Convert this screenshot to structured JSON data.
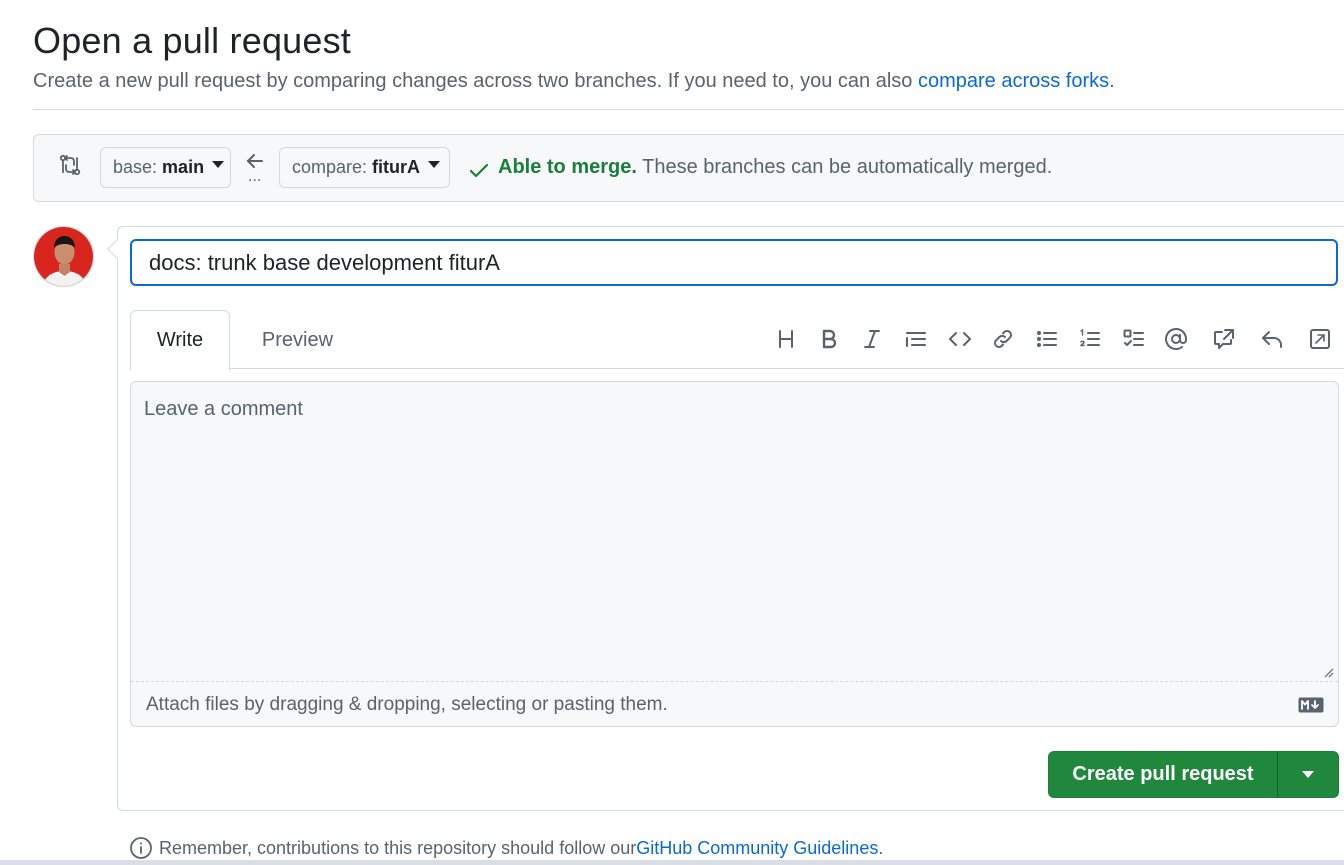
{
  "header": {
    "title": "Open a pull request",
    "subtitle": "Create a new pull request by comparing changes across two branches. If you need to, you can also ",
    "subtitle_link": "compare across forks",
    "subtitle_end": "."
  },
  "range": {
    "compare_icon": "git-compare-icon",
    "base_prefix": "base:",
    "base_branch": "main",
    "compare_prefix": "compare:",
    "compare_branch": "fiturA",
    "swap_arrow": "arrow-left-icon",
    "ellipsis": "...",
    "merge_status_bold": "Able to merge.",
    "merge_status_text": " These branches can be automatically merged.",
    "merge_color": "#1a7f37"
  },
  "composer": {
    "title_value": "docs: trunk base development fiturA",
    "tabs": [
      {
        "label": "Write",
        "active": true
      },
      {
        "label": "Preview",
        "active": false
      }
    ],
    "toolbar_icons": [
      "heading-icon",
      "bold-icon",
      "italic-icon",
      "quote-icon",
      "code-icon",
      "link-icon",
      "unordered-list-icon",
      "ordered-list-icon",
      "task-list-icon",
      "mention-icon",
      "cross-reference-icon",
      "saved-reply-icon",
      "fullscreen-icon"
    ],
    "comment_placeholder": "Leave a comment",
    "attach_text": "Attach files by dragging & dropping, selecting or pasting them.",
    "markdown_icon": "markdown-icon"
  },
  "actions": {
    "create_label": "Create pull request",
    "primary_color": "#1f883d"
  },
  "footer": {
    "note": "Remember, contributions to this repository should follow our ",
    "link": "GitHub Community Guidelines",
    "end": "."
  }
}
